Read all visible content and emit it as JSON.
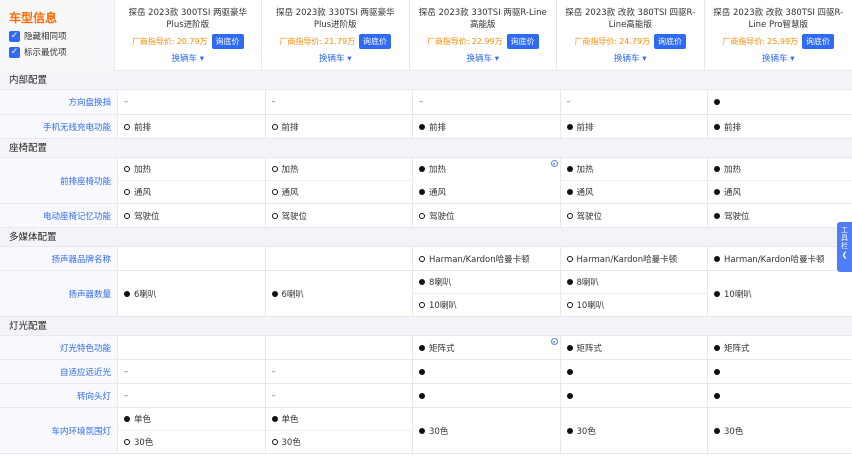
{
  "sidebar_header": {
    "title": "车型信息",
    "options": [
      {
        "label": "隐藏相同项",
        "checked": true
      },
      {
        "label": "标示最优项",
        "checked": true
      }
    ]
  },
  "cars": [
    {
      "name": "探岳 2023款 300TSI 两驱豪华Plus进阶版",
      "price_label": "厂商指导价:",
      "price": "20.79万",
      "inquiry": "询底价",
      "switch": "换辆车"
    },
    {
      "name": "探岳 2023款 330TSI 两驱豪华Plus进阶版",
      "price_label": "厂商指导价:",
      "price": "21.79万",
      "inquiry": "询底价",
      "switch": "换辆车"
    },
    {
      "name": "探岳 2023款 330TSI 两驱R-Line高能版",
      "price_label": "厂商指导价:",
      "price": "22.99万",
      "inquiry": "询底价",
      "switch": "换辆车"
    },
    {
      "name": "探岳 2023款 改款 380TSI 四驱R-Line高能版",
      "price_label": "厂商指导价:",
      "price": "24.79万",
      "inquiry": "询底价",
      "switch": "换辆车"
    },
    {
      "name": "探岳 2023款 改款 380TSI 四驱R-Line Pro智慧版",
      "price_label": "厂商指导价:",
      "price": "25.99万",
      "inquiry": "询底价",
      "switch": "换辆车"
    }
  ],
  "sections": [
    {
      "title": "内部配置",
      "rows": [
        {
          "label": "方向盘换挡",
          "height": 25,
          "cells": [
            [
              {
                "sym": "dash",
                "text": "–"
              }
            ],
            [
              {
                "sym": "dash",
                "text": "–"
              }
            ],
            [
              {
                "sym": "dash",
                "text": "–"
              }
            ],
            [
              {
                "sym": "dash",
                "text": "–"
              }
            ],
            [
              {
                "sym": "std",
                "text": ""
              }
            ]
          ]
        },
        {
          "label": "手机无线充电功能",
          "height": 24,
          "cells": [
            [
              {
                "sym": "opt",
                "text": "前排"
              }
            ],
            [
              {
                "sym": "opt",
                "text": "前排"
              }
            ],
            [
              {
                "sym": "std",
                "text": "前排"
              }
            ],
            [
              {
                "sym": "std",
                "text": "前排"
              }
            ],
            [
              {
                "sym": "std",
                "text": "前排"
              }
            ]
          ]
        }
      ]
    },
    {
      "title": "座椅配置",
      "rows": [
        {
          "label": "前排座椅功能",
          "height": 46,
          "cells": [
            [
              {
                "sym": "opt",
                "text": "加热"
              },
              {
                "sym": "opt",
                "text": "通风"
              }
            ],
            [
              {
                "sym": "opt",
                "text": "加热"
              },
              {
                "sym": "opt",
                "text": "通风"
              }
            ],
            [
              {
                "sym": "std",
                "text": "加热",
                "icon": true
              },
              {
                "sym": "std",
                "text": "通风"
              }
            ],
            [
              {
                "sym": "std",
                "text": "加热"
              },
              {
                "sym": "std",
                "text": "通风"
              }
            ],
            [
              {
                "sym": "std",
                "text": "加热"
              },
              {
                "sym": "std",
                "text": "通风"
              }
            ]
          ]
        },
        {
          "label": "电动座椅记忆功能",
          "height": 24,
          "cells": [
            [
              {
                "sym": "opt",
                "text": "驾驶位"
              }
            ],
            [
              {
                "sym": "opt",
                "text": "驾驶位"
              }
            ],
            [
              {
                "sym": "opt",
                "text": "驾驶位"
              }
            ],
            [
              {
                "sym": "opt",
                "text": "驾驶位"
              }
            ],
            [
              {
                "sym": "std",
                "text": "驾驶位"
              }
            ]
          ]
        }
      ]
    },
    {
      "title": "多媒体配置",
      "rows": [
        {
          "label": "扬声器品牌名称",
          "height": 24,
          "cells": [
            [
              {
                "sym": "none",
                "text": ""
              }
            ],
            [
              {
                "sym": "none",
                "text": ""
              }
            ],
            [
              {
                "sym": "opt",
                "text": "Harman/Kardon哈曼卡顿"
              }
            ],
            [
              {
                "sym": "opt",
                "text": "Harman/Kardon哈曼卡顿"
              }
            ],
            [
              {
                "sym": "std",
                "text": "Harman/Kardon哈曼卡顿"
              }
            ]
          ]
        },
        {
          "label": "扬声器数量",
          "height": 46,
          "cells": [
            [
              {
                "sym": "std",
                "text": "6喇叭"
              }
            ],
            [
              {
                "sym": "std",
                "text": "6喇叭"
              }
            ],
            [
              {
                "sym": "std",
                "text": "8喇叭"
              },
              {
                "sym": "opt",
                "text": "10喇叭"
              }
            ],
            [
              {
                "sym": "std",
                "text": "8喇叭"
              },
              {
                "sym": "opt",
                "text": "10喇叭"
              }
            ],
            [
              {
                "sym": "std",
                "text": "10喇叭"
              }
            ]
          ]
        }
      ]
    },
    {
      "title": "灯光配置",
      "rows": [
        {
          "label": "灯光特色功能",
          "height": 24,
          "cells": [
            [
              {
                "sym": "none",
                "text": ""
              }
            ],
            [
              {
                "sym": "none",
                "text": ""
              }
            ],
            [
              {
                "sym": "std",
                "text": "矩阵式",
                "icon": true
              }
            ],
            [
              {
                "sym": "std",
                "text": "矩阵式"
              }
            ],
            [
              {
                "sym": "std",
                "text": "矩阵式"
              }
            ]
          ]
        },
        {
          "label": "自适应远近光",
          "height": 24,
          "cells": [
            [
              {
                "sym": "dash",
                "text": "–"
              }
            ],
            [
              {
                "sym": "dash",
                "text": "–"
              }
            ],
            [
              {
                "sym": "std",
                "text": ""
              }
            ],
            [
              {
                "sym": "std",
                "text": ""
              }
            ],
            [
              {
                "sym": "std",
                "text": ""
              }
            ]
          ]
        },
        {
          "label": "转向头灯",
          "height": 24,
          "cells": [
            [
              {
                "sym": "dash",
                "text": "–"
              }
            ],
            [
              {
                "sym": "dash",
                "text": "–"
              }
            ],
            [
              {
                "sym": "std",
                "text": ""
              }
            ],
            [
              {
                "sym": "std",
                "text": ""
              }
            ],
            [
              {
                "sym": "std",
                "text": ""
              }
            ]
          ]
        },
        {
          "label": "车内环境氛围灯",
          "height": 46,
          "cells": [
            [
              {
                "sym": "std",
                "text": "单色"
              },
              {
                "sym": "opt",
                "text": "30色"
              }
            ],
            [
              {
                "sym": "std",
                "text": "单色"
              },
              {
                "sym": "opt",
                "text": "30色"
              }
            ],
            [
              {
                "sym": "std",
                "text": "30色"
              }
            ],
            [
              {
                "sym": "std",
                "text": "30色"
              }
            ],
            [
              {
                "sym": "std",
                "text": "30色"
              }
            ]
          ]
        }
      ]
    }
  ],
  "toolbox": {
    "label": "工具栏",
    "arrow": "❮"
  },
  "colors": {
    "accent": "#2f6bf2",
    "price": "#ff8a00",
    "title": "#ff6a00"
  }
}
